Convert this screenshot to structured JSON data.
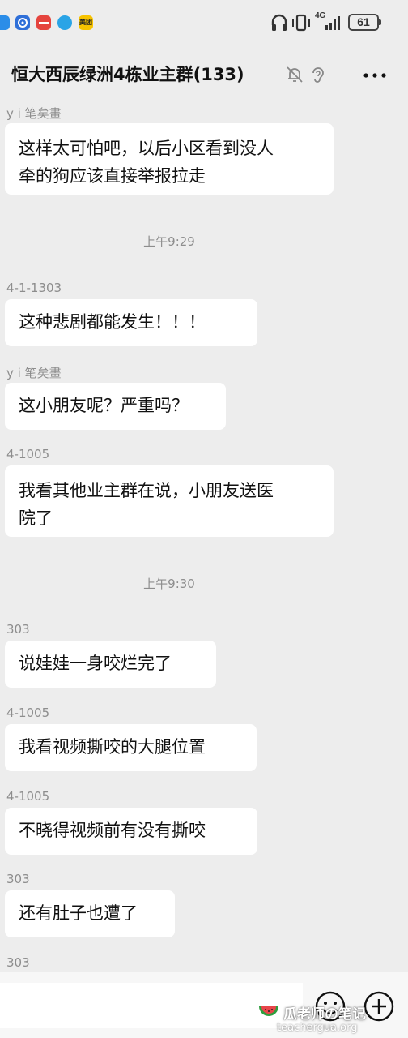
{
  "status_bar": {
    "network": "4G",
    "battery": "61",
    "app_icons": [
      {
        "name": "browser",
        "color": "#2b8de8"
      },
      {
        "name": "compass",
        "color": "#2f6fd8"
      },
      {
        "name": "red-app",
        "color": "#e5443e"
      },
      {
        "name": "bird-app",
        "color": "#2aa4e6"
      },
      {
        "name": "meituan",
        "color": "#f7c300",
        "label": "美团"
      }
    ]
  },
  "header": {
    "title": "恒大西辰绿洲4栋业主群(133)",
    "icons": [
      "bell-muted-icon",
      "ear-icon",
      "more-icon"
    ]
  },
  "messages": [
    {
      "sender": "y i 笔矣畫",
      "lines": [
        "这样太可怕吧，以后小区看到没人",
        "牵的狗应该直接举报拉走"
      ]
    },
    {
      "time": "上午9:29"
    },
    {
      "sender": "4-1-1303",
      "lines": [
        "这种悲剧都能发生！！！"
      ]
    },
    {
      "sender": "y i 笔矣畫",
      "lines": [
        "这小朋友呢？严重吗？"
      ]
    },
    {
      "sender": "4-1005",
      "lines": [
        "我看其他业主群在说，小朋友送医",
        "院了"
      ]
    },
    {
      "time": "上午9:30"
    },
    {
      "sender": "303",
      "lines": [
        "说娃娃一身咬烂完了"
      ]
    },
    {
      "sender": "4-1005",
      "lines": [
        "我看视频撕咬的大腿位置"
      ]
    },
    {
      "sender": "4-1005",
      "lines": [
        "不晓得视频前有没有撕咬"
      ]
    },
    {
      "sender": "303",
      "lines": [
        "还有肚子也遭了"
      ]
    },
    {
      "sender": "303",
      "lines": []
    }
  ],
  "input_bar": {
    "value": "",
    "icons": [
      "emoji-icon",
      "plus-icon"
    ]
  },
  "watermark": {
    "text": "瓜老师の笔记",
    "url": "teachergua.org"
  }
}
